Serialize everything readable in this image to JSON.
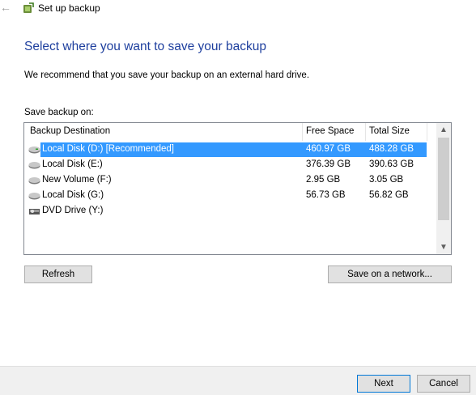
{
  "window": {
    "title": "Set up backup"
  },
  "main": {
    "heading": "Select where you want to save your backup",
    "recommendation": "We recommend that you save your backup on an external hard drive.",
    "save_on_label": "Save backup on:"
  },
  "list": {
    "columns": [
      "Backup Destination",
      "Free Space",
      "Total Size"
    ],
    "rows": [
      {
        "name": "Local Disk (D:) [Recommended]",
        "free": "460.97 GB",
        "total": "488.28 GB",
        "icon": "hard-drive-icon",
        "selected": true
      },
      {
        "name": "Local Disk (E:)",
        "free": "376.39 GB",
        "total": "390.63 GB",
        "icon": "hard-drive-icon",
        "selected": false
      },
      {
        "name": "New Volume (F:)",
        "free": "2.95 GB",
        "total": "3.05 GB",
        "icon": "hard-drive-icon",
        "selected": false
      },
      {
        "name": "Local Disk (G:)",
        "free": "56.73 GB",
        "total": "56.82 GB",
        "icon": "hard-drive-icon",
        "selected": false
      },
      {
        "name": "DVD Drive (Y:)",
        "free": "",
        "total": "",
        "icon": "dvd-drive-icon",
        "selected": false
      }
    ]
  },
  "buttons": {
    "refresh": "Refresh",
    "save_network": "Save on a network...",
    "next": "Next",
    "cancel": "Cancel"
  },
  "colors": {
    "heading": "#1e3f9e",
    "selection": "#3399ff"
  }
}
